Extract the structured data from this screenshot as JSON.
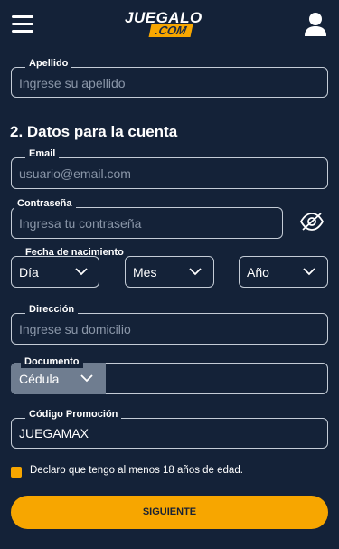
{
  "header": {
    "logo_top": "JUEGALO",
    "logo_bottom": ".COM"
  },
  "form": {
    "apellido": {
      "label": "Apellido",
      "placeholder": "Ingrese su apellido"
    },
    "section_title": "2. Datos para la cuenta",
    "email": {
      "label": "Email",
      "placeholder": "usuario@email.com"
    },
    "password": {
      "label": "Contraseña",
      "placeholder": "Ingresa tu contraseña"
    },
    "birth": {
      "label": "Fecha de nacimiento",
      "day": "Día",
      "month": "Mes",
      "year": "Año"
    },
    "address": {
      "label": "Dirección",
      "placeholder": "Ingrese su domicilio"
    },
    "document": {
      "label": "Documento",
      "type_value": "Cédula",
      "number_value": ""
    },
    "promo": {
      "label": "Código Promoción",
      "value": "JUEGAMAX"
    },
    "age_check": {
      "label": "Declaro que tengo al menos 18 años de edad.",
      "checked": true
    },
    "submit_label": "SIGUIENTE"
  },
  "colors": {
    "background": "#142238",
    "accent": "#f7a600",
    "border": "#c4ccd6"
  },
  "icons": [
    "hamburger-menu-icon",
    "user-icon",
    "eye-slash-icon",
    "chevron-down-icon"
  ]
}
